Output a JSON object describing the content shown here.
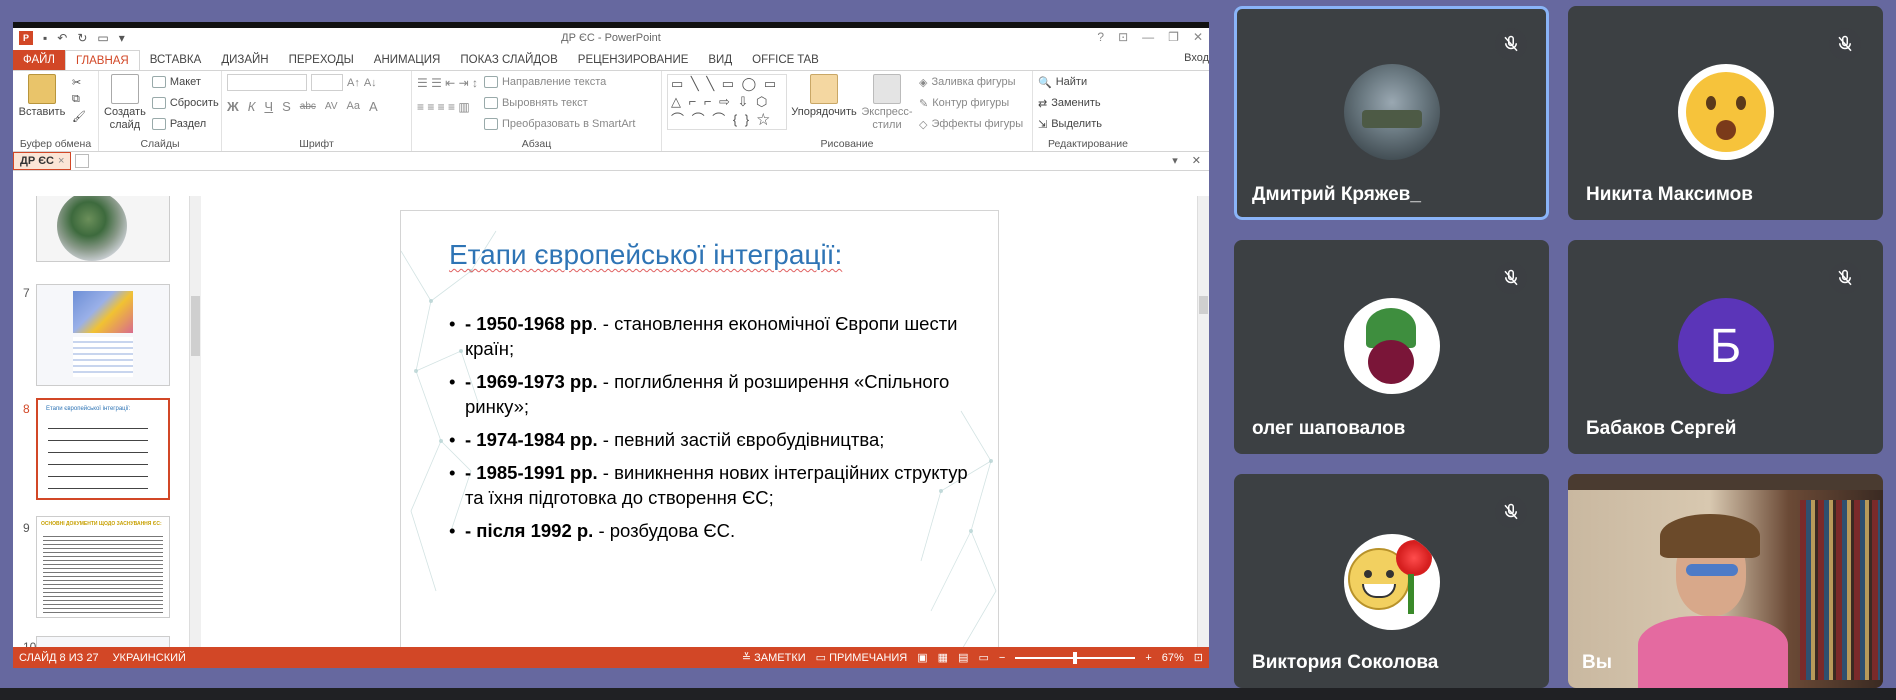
{
  "powerpoint": {
    "window_title": "ДР ЄС - PowerPoint",
    "app_icon": "P",
    "login": "Вход",
    "tabs": [
      "ФАЙЛ",
      "ГЛАВНАЯ",
      "ВСТАВКА",
      "ДИЗАЙН",
      "ПЕРЕХОДЫ",
      "АНИМАЦИЯ",
      "ПОКАЗ СЛАЙДОВ",
      "РЕЦЕНЗИРОВАНИЕ",
      "ВИД",
      "OFFICE TAB"
    ],
    "ribbon": {
      "clipboard": {
        "paste": "Вставить",
        "label": "Буфер обмена"
      },
      "slides": {
        "new_slide": "Создать слайд",
        "layout": "Макет",
        "reset": "Сбросить",
        "section": "Раздел",
        "label": "Слайды"
      },
      "font": {
        "label": "Шрифт",
        "buttons": [
          "Ж",
          "К",
          "Ч",
          "S",
          "abc",
          "AV",
          "Aa",
          "A"
        ]
      },
      "paragraph": {
        "text_direction": "Направление текста",
        "align_text": "Выровнять текст",
        "smartart": "Преобразовать в SmartArt",
        "label": "Абзац"
      },
      "drawing": {
        "arrange": "Упорядочить",
        "quick_styles": "Экспресс-стили",
        "fill": "Заливка фигуры",
        "outline": "Контур фигуры",
        "effects": "Эффекты фигуры",
        "label": "Рисование"
      },
      "editing": {
        "find": "Найти",
        "replace": "Заменить",
        "select": "Выделить",
        "label": "Редактирование"
      }
    },
    "doc_tab": "ДР ЄС",
    "thumbnails": [
      {
        "num": "7"
      },
      {
        "num": "8",
        "title": "Етапи європейської інтеграції:"
      },
      {
        "num": "9",
        "title": "ОСНОВНІ ДОКУМЕНТИ ЩОДО ЗАСНУВАННЯ ЄС:"
      },
      {
        "num": "10"
      }
    ],
    "slide": {
      "title": "Етапи європейської інтеграції:",
      "bullets": [
        {
          "bold": "- 1950-1968 рр",
          "text": ". - становлення економічної Європи шести країн;"
        },
        {
          "bold": "- 1969-1973 рр.",
          "text": " - поглиблення й розширення «Спільного ринку»;"
        },
        {
          "bold": "- 1974-1984 рр.",
          "text": " - певний застій євробудівництва;"
        },
        {
          "bold": "- 1985-1991 рр.",
          "text": " - виникнення нових інтеграційних структур та їхня підготовка до створення ЄС;"
        },
        {
          "bold": "- після 1992 р.",
          "text": " - розбудова ЄС."
        }
      ]
    },
    "status": {
      "slide": "СЛАЙД 8 ИЗ 27",
      "language": "УКРАИНСКИЙ",
      "notes": "ЗАМЕТКИ",
      "comments": "ПРИМЕЧАНИЯ",
      "zoom": "67%"
    }
  },
  "participants": [
    {
      "name": "Дмитрий Кряжев_",
      "avatar": "tank-photo",
      "muted": true,
      "speaking": true
    },
    {
      "name": "Никита Максимов",
      "avatar": "emoji-face",
      "muted": true
    },
    {
      "name": "олег шаповалов",
      "avatar": "beet-photo",
      "muted": true
    },
    {
      "name": "Бабаков Сергей",
      "avatar": "letter",
      "initial": "Б",
      "avatar_color": "#5b35b8",
      "muted": true
    },
    {
      "name": "Виктория Соколова",
      "avatar": "smiley-flowers",
      "muted": true
    },
    {
      "name": "Вы",
      "avatar": "camera"
    }
  ]
}
